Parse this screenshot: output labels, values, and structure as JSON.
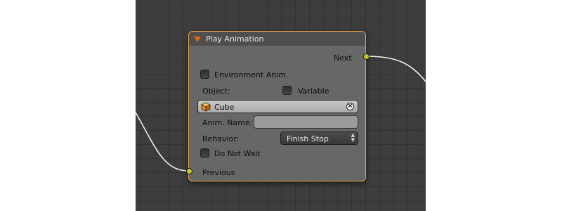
{
  "node": {
    "title": "Play Animation",
    "output_socket": "Next",
    "input_socket": "Previous",
    "environment_anim": {
      "label": "Environment Anim.",
      "checked": false
    },
    "object_label": "Object:",
    "variable": {
      "label": "Variable",
      "checked": false
    },
    "object_value": "Cube",
    "anim_name": {
      "label": "Anim. Name:",
      "value": ""
    },
    "behavior": {
      "label": "Behavior:",
      "value": "Finish Stop"
    },
    "do_not_wait": {
      "label": "Do Not Wait",
      "checked": false
    }
  },
  "icons": {
    "collapse": "triangle-down-icon",
    "object": "cube-icon",
    "clear": "close-icon",
    "select": "up-down-arrows-icon"
  },
  "colors": {
    "grid_background": "#3d3d3d",
    "node_body": "#676767",
    "node_header": "#4e4e4e",
    "node_border_selected": "#e8a33a",
    "socket": "#c7c729",
    "wire": "#f0f0f0",
    "collapse_arrow": "#e26a12"
  }
}
